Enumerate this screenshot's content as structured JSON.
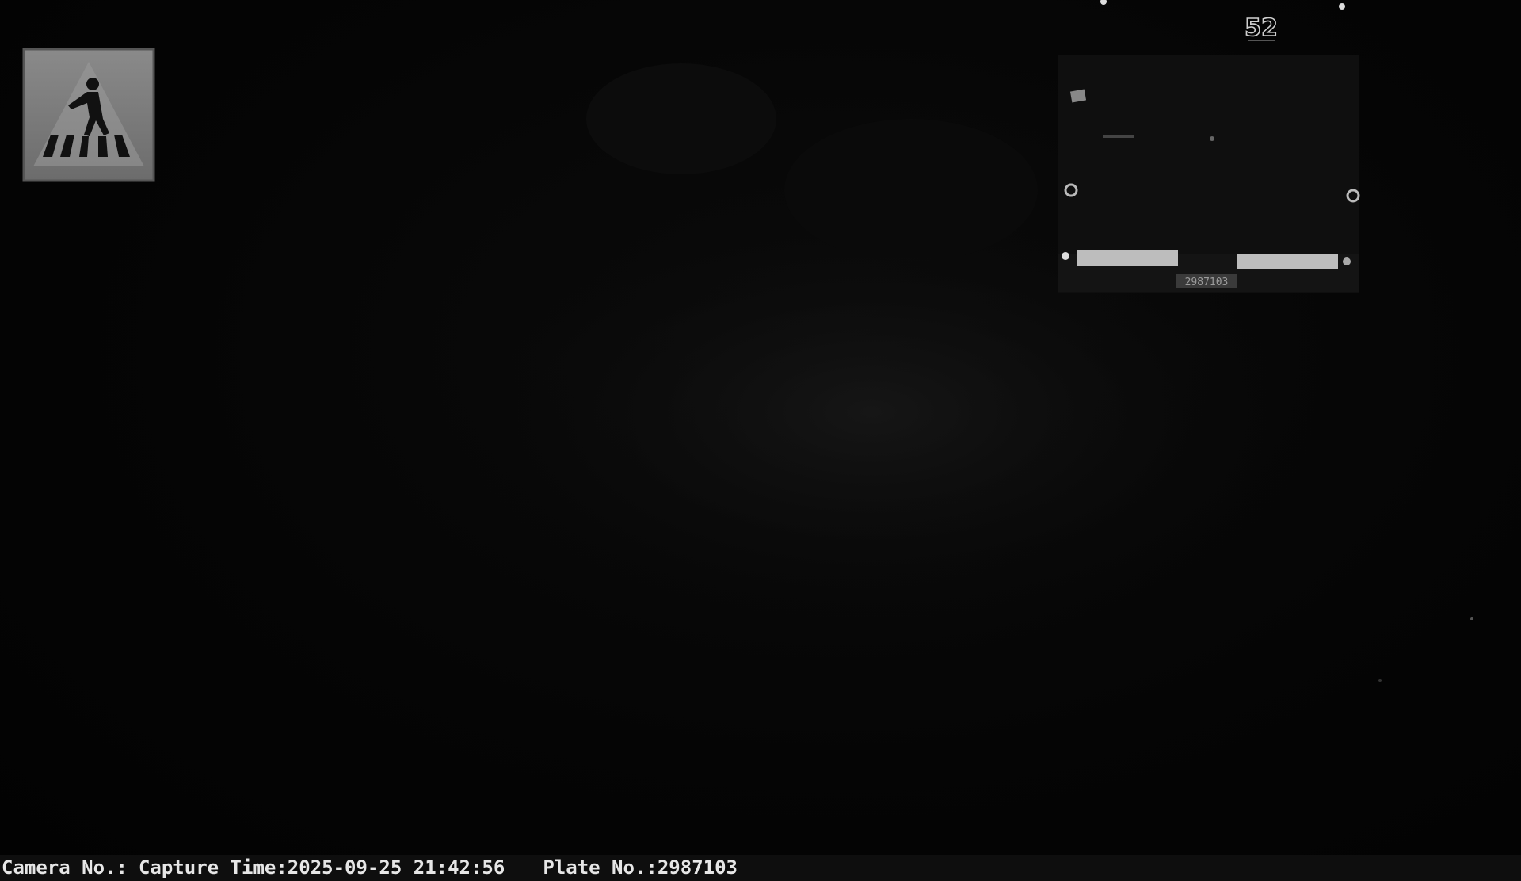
{
  "overlay": {
    "camera_label": "Camera No.:",
    "capture_label": "Capture Time:",
    "capture_time": "2025-09-25 21:42:56",
    "plate_label": "Plate No.:",
    "plate_number": "2987103"
  },
  "scene": {
    "truck_plate_text": "2987103",
    "truck_rear_mark": "52",
    "sign_type": "pedestrian-crossing-sign-icon"
  },
  "colors": {
    "background": "#030303",
    "overlay_text": "#e6e6e6",
    "overlay_bar": "#0e0e0e"
  }
}
